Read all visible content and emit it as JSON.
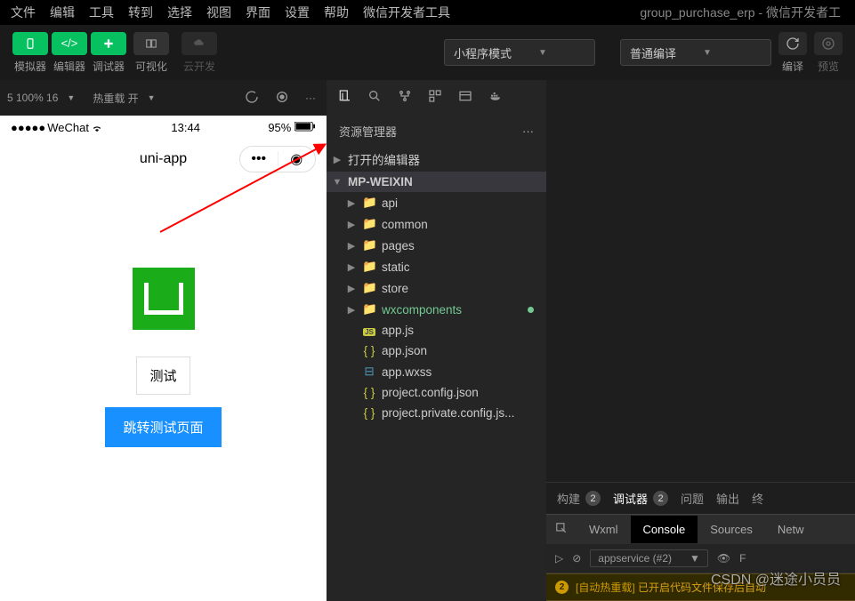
{
  "menu": {
    "items": [
      "文件",
      "编辑",
      "工具",
      "转到",
      "选择",
      "视图",
      "界面",
      "设置",
      "帮助",
      "微信开发者工具"
    ],
    "title": "group_purchase_erp - 微信开发者工"
  },
  "toolbar": {
    "labels": [
      "模拟器",
      "编辑器",
      "调试器",
      "可视化",
      "云开发"
    ],
    "mode": "小程序模式",
    "compile": "普通编译",
    "compile_label": "编译",
    "preview_label": "预览"
  },
  "sim_bar": {
    "zoom": "5 100% 16",
    "reload": "热重载 开"
  },
  "phone": {
    "carrier": "WeChat",
    "time": "13:44",
    "battery": "95%",
    "title": "uni-app",
    "test_label": "测试",
    "jump_label": "跳转测试页面"
  },
  "explorer": {
    "title": "资源管理器",
    "open_editors": "打开的编辑器",
    "root": "MP-WEIXIN",
    "folders": [
      "api",
      "common",
      "pages",
      "static",
      "store",
      "wxcomponents"
    ],
    "files": [
      "app.js",
      "app.json",
      "app.wxss",
      "project.config.json",
      "project.private.config.js..."
    ]
  },
  "debug": {
    "tabs": [
      "构建",
      "调试器",
      "问题",
      "输出",
      "终"
    ],
    "badges": [
      "2",
      "2"
    ],
    "devtools": [
      "Wxml",
      "Console",
      "Sources",
      "Netw"
    ],
    "appservice": "appservice (#2)",
    "msg_tag": "[自动热重载]",
    "msg_text": "已开启代码文件保存后自动"
  },
  "watermark": "CSDN @迷途小员员"
}
